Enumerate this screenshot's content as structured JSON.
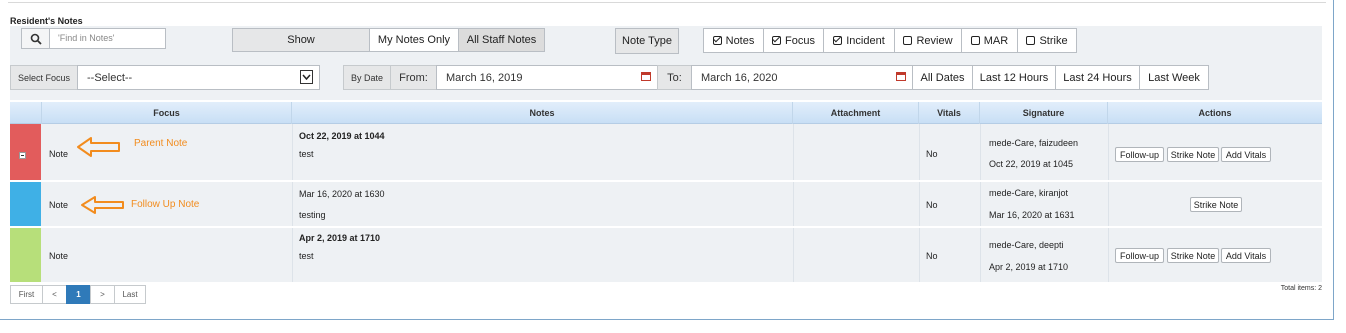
{
  "section_title": "Resident's Notes",
  "search": {
    "placeholder": "'Find in  Notes'"
  },
  "show": {
    "label": "Show",
    "options": [
      "My Notes Only",
      "All Staff Notes"
    ],
    "selected": "All Staff Notes"
  },
  "note_type": {
    "label": "Note Type",
    "options": [
      {
        "label": "Notes",
        "checked": true
      },
      {
        "label": "Focus",
        "checked": true
      },
      {
        "label": "Incident",
        "checked": true
      },
      {
        "label": "Review",
        "checked": false
      },
      {
        "label": "MAR",
        "checked": false
      },
      {
        "label": "Strike",
        "checked": false
      }
    ]
  },
  "focus": {
    "label": "Select Focus",
    "value": "--Select--"
  },
  "date_filter": {
    "by_date": "By Date",
    "from_label": "From:",
    "from_value": "March 16, 2019",
    "to_label": "To:",
    "to_value": "March 16, 2020",
    "ranges": [
      "All Dates",
      "Last 12 Hours",
      "Last 24 Hours",
      "Last Week"
    ]
  },
  "table": {
    "columns": [
      "Focus",
      "Notes",
      "Attachment",
      "Vitals",
      "Signature",
      "Actions"
    ],
    "rows": [
      {
        "color": "#e25c5c",
        "focus": "Note",
        "note_title": "Oct 22, 2019 at 1044",
        "note_text": "test",
        "vitals": "No",
        "sig_name": "mede-Care, faizudeen",
        "sig_date": "Oct 22, 2019 at 1045",
        "actions": [
          "Follow-up",
          "Strike Note",
          "Add Vitals"
        ]
      },
      {
        "color": "#3fb0e6",
        "focus": "Note",
        "note_title": "Mar 16, 2020 at 1630",
        "note_text": "testing",
        "vitals": "No",
        "sig_name": "mede-Care, kiranjot",
        "sig_date": "Mar 16, 2020 at 1631",
        "actions": [
          "Strike Note"
        ]
      },
      {
        "color": "#b7df7a",
        "focus": "Note",
        "note_title": "Apr 2, 2019 at 1710",
        "note_text": "test",
        "vitals": "No",
        "sig_name": "mede-Care, deepti",
        "sig_date": "Apr 2, 2019 at 1710",
        "actions": [
          "Follow-up",
          "Strike Note",
          "Add Vitals"
        ]
      }
    ]
  },
  "annotations": {
    "parent": "Parent Note",
    "followup": "Follow Up Note"
  },
  "pager": {
    "first": "First",
    "prev": "<",
    "page": "1",
    "next": ">",
    "last": "Last",
    "total": "Total items: 2"
  },
  "colors": {
    "accent": "#2f7ab9",
    "annotation": "#f28c1e"
  }
}
